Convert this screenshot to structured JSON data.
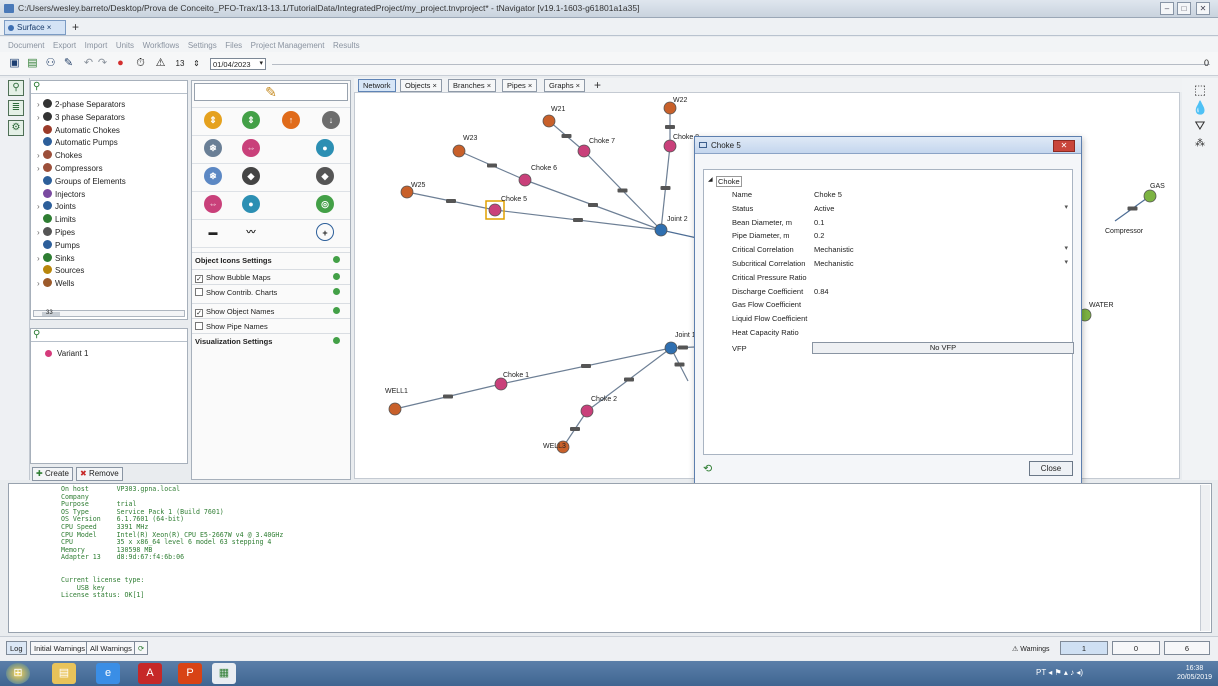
{
  "window": {
    "title": "C:/Users/wesley.barreto/Desktop/Prova de Conceito_PFO-Trax/13-13.1/TutorialData/IntegratedProject/my_project.tnvproject* - tNavigator [v19.1-1603-g61801a1a35]"
  },
  "doc_tab": {
    "label": "Surface ×"
  },
  "menu": [
    "Document",
    "Export",
    "Import",
    "Units",
    "Workflows",
    "Settings",
    "Files",
    "Project Management",
    "Results"
  ],
  "toolbar": {
    "date_value": "01/04/2023",
    "step_value": "13",
    "right_number": "0"
  },
  "tree": {
    "items": [
      {
        "label": "2-phase Separators",
        "caret": "›"
      },
      {
        "label": "3 phase Separators",
        "caret": "›"
      },
      {
        "label": "Automatic Chokes",
        "caret": ""
      },
      {
        "label": "Automatic Pumps",
        "caret": ""
      },
      {
        "label": "Chokes",
        "caret": "›"
      },
      {
        "label": "Compressors",
        "caret": "›"
      },
      {
        "label": "Groups of Elements",
        "caret": ""
      },
      {
        "label": "Injectors",
        "caret": ""
      },
      {
        "label": "Joints",
        "caret": "›"
      },
      {
        "label": "Limits",
        "caret": ""
      },
      {
        "label": "Pipes",
        "caret": "›"
      },
      {
        "label": "Pumps",
        "caret": ""
      },
      {
        "label": "Sinks",
        "caret": "›"
      },
      {
        "label": "Sources",
        "caret": ""
      },
      {
        "label": "Wells",
        "caret": "›"
      }
    ],
    "scroll_label": "33"
  },
  "variants": {
    "items": [
      "Variant 1"
    ],
    "create_label": "Create",
    "remove_label": "Remove"
  },
  "palette": {
    "object_icons_settings": "Object Icons Settings",
    "show_bubble_maps": "Show Bubble Maps",
    "show_contrib_charts": "Show Contrib. Charts",
    "show_object_names": "Show Object Names",
    "show_pipe_names": "Show Pipe Names",
    "visualization_settings": "Visualization Settings"
  },
  "canvas_tabs": [
    "Network",
    "Objects ×",
    "Branches ×",
    "Pipes ×",
    "Graphs ×"
  ],
  "network": {
    "labels": [
      "W21",
      "W22",
      "W23",
      "W25",
      "Choke 5",
      "Choke 6",
      "Choke 7",
      "Choke 8",
      "Joint 2",
      "GAS",
      "Compressor",
      "WATER",
      "Joint 1",
      "Choke 1",
      "Choke 2",
      "WELL1",
      "WELL3"
    ]
  },
  "dialog": {
    "title": "Choke 5",
    "close_x": "✕",
    "section": "Choke",
    "properties": [
      {
        "name": "Name",
        "value": "Choke 5",
        "dropdown": false
      },
      {
        "name": "Status",
        "value": "Active",
        "dropdown": true
      },
      {
        "name": "Bean Diameter, m",
        "value": "0.1",
        "dropdown": false
      },
      {
        "name": "Pipe Diameter, m",
        "value": "0.2",
        "dropdown": false
      },
      {
        "name": "Critical Correlation",
        "value": "Mechanistic",
        "dropdown": true
      },
      {
        "name": "Subcritical Correlation",
        "value": "Mechanistic",
        "dropdown": true
      },
      {
        "name": "Critical Pressure Ratio",
        "value": "",
        "dropdown": false
      },
      {
        "name": "Discharge Coefficient",
        "value": "0.84",
        "dropdown": false
      },
      {
        "name": "Gas Flow Coefficient",
        "value": "",
        "dropdown": false
      },
      {
        "name": "Liquid Flow Coefficient",
        "value": "",
        "dropdown": false
      },
      {
        "name": "Heat Capacity Ratio",
        "value": "",
        "dropdown": false
      }
    ],
    "vfp_label": "VFP",
    "vfp_button": "No VFP",
    "close_button": "Close"
  },
  "log": {
    "text": "On host       VP303.gpna.local\nCompany\nPurpose       trial\nOS Type       Service Pack 1 (Build 7601)\nOS Version    6.1.7601 (64-bit)\nCPU Speed     3391 MHz\nCPU Model     Intel(R) Xeon(R) CPU E5-2667W v4 @ 3.40GHz\nCPU           35 x x86_64 level 6 model 63 stepping 4\nMemory        130598 MB\nAdapter 13    d8:9d:67:f4:6b:06\n\n\nCurrent license type:\n    USB key\nLicense status: OK[1]"
  },
  "statusbar": {
    "log_tab": "Log",
    "initial_warnings": "Initial Warnings",
    "all_warnings": "All Warnings",
    "warnings_label": "Warnings",
    "count_a": "1",
    "count_b": "0",
    "count_c": "6"
  },
  "taskbar": {
    "time": "16:38",
    "date": "20/05/2019",
    "lang": "PT"
  },
  "colors": {
    "accent": "#3d6fb3",
    "well": "#c8602a",
    "choke": "#c9407a",
    "joint": "#2f6fb0",
    "log_text": "#2e7d32"
  }
}
